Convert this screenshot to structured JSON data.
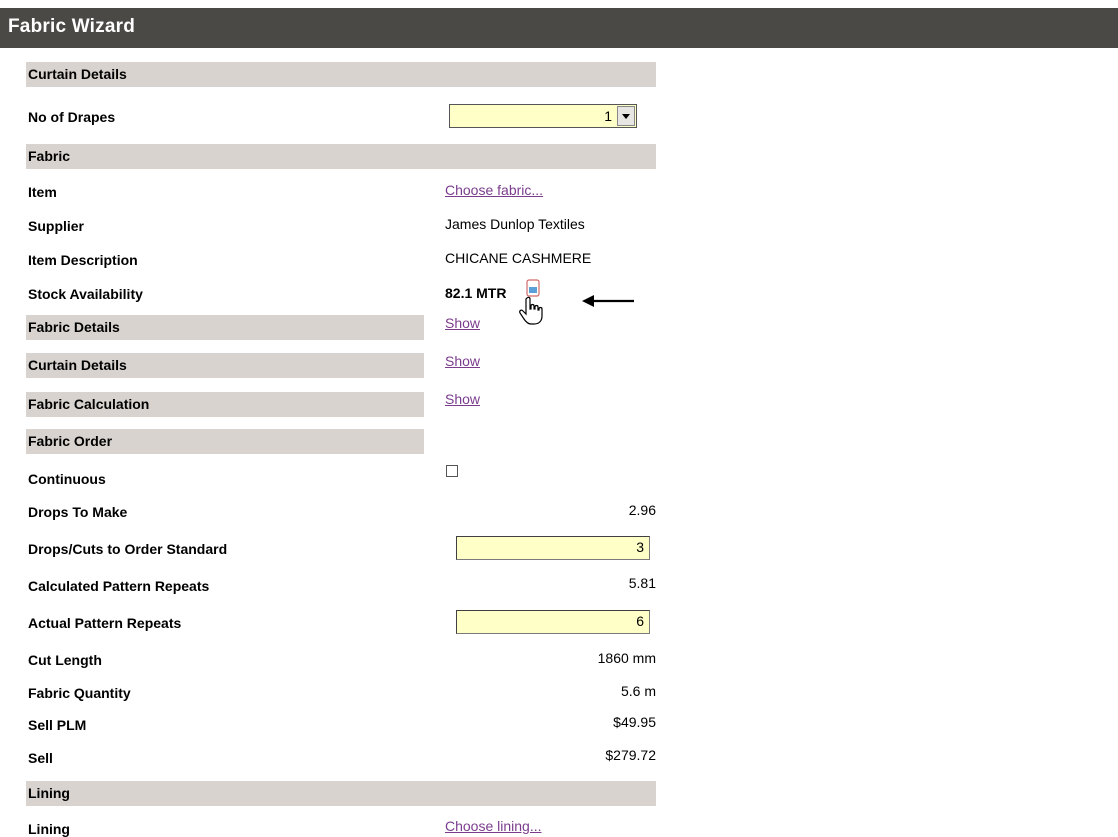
{
  "window": {
    "title": "Fabric Wizard"
  },
  "sections": {
    "curtain_details": "Curtain Details",
    "fabric": "Fabric",
    "fabric_details": "Fabric Details",
    "curtain_details_2": "Curtain Details",
    "fabric_calculation": "Fabric Calculation",
    "fabric_order": "Fabric Order",
    "lining": "Lining"
  },
  "fields": {
    "no_of_drapes": {
      "label": "No of Drapes",
      "value": "1"
    },
    "item": {
      "label": "Item",
      "link": "Choose fabric..."
    },
    "supplier": {
      "label": "Supplier",
      "value": "James Dunlop Textiles"
    },
    "item_description": {
      "label": "Item Description",
      "value": "CHICANE CASHMERE"
    },
    "stock_availability": {
      "label": "Stock Availability",
      "value": "82.1 MTR"
    },
    "show_links": {
      "fabric_details": "Show",
      "curtain_details": "Show",
      "fabric_calculation": "Show"
    },
    "continuous": {
      "label": "Continuous",
      "checked": false
    },
    "drops_to_make": {
      "label": "Drops To Make",
      "value": "2.96"
    },
    "drops_cuts_to_order": {
      "label": "Drops/Cuts to Order Standard",
      "value": "3"
    },
    "calculated_pattern_repeats": {
      "label": "Calculated Pattern Repeats",
      "value": "5.81"
    },
    "actual_pattern_repeats": {
      "label": "Actual Pattern Repeats",
      "value": "6"
    },
    "cut_length": {
      "label": "Cut Length",
      "value": "1860 mm"
    },
    "fabric_quantity": {
      "label": "Fabric Quantity",
      "value": "5.6 m"
    },
    "sell_plm": {
      "label": "Sell PLM",
      "value": "$49.95"
    },
    "sell": {
      "label": "Sell",
      "value": "$279.72"
    },
    "lining": {
      "label": "Lining",
      "link": "Choose lining..."
    }
  },
  "icons": {
    "stock": "stock-info-icon",
    "cursor": "hand-pointer-icon",
    "annotation": "left-arrow-icon"
  },
  "colors": {
    "titlebar": "#4a4945",
    "section_bg": "#d8d3cf",
    "input_bg": "#ffffc8",
    "link": "#7b3c8e"
  }
}
